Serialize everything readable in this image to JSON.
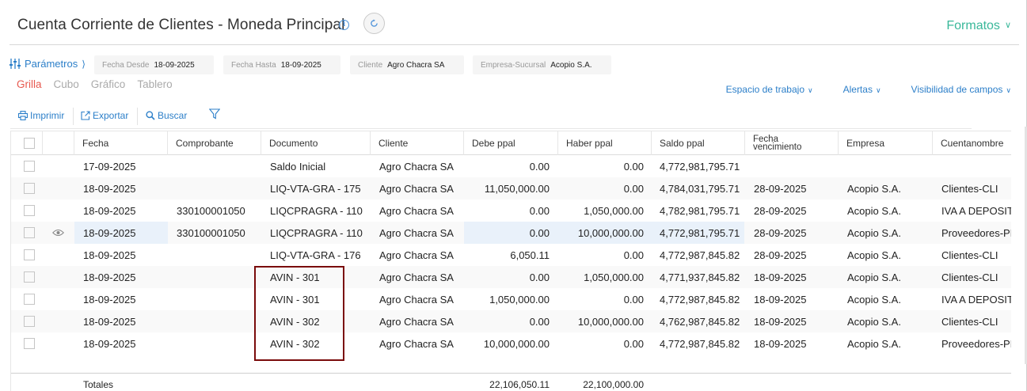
{
  "header": {
    "title": "Cuenta Corriente de Clientes - Moneda Principal",
    "formatos_label": "Formatos"
  },
  "params": {
    "label": "Parámetros",
    "filters": [
      {
        "label": "Fecha Desde",
        "value": "18-09-2025"
      },
      {
        "label": "Fecha Hasta",
        "value": "18-09-2025"
      },
      {
        "label": "Cliente",
        "value": "Agro Chacra SA"
      },
      {
        "label": "Empresa-Sucursal",
        "value": "Acopio S.A."
      }
    ]
  },
  "view_tabs": [
    "Grilla",
    "Cubo",
    "Gráfico",
    "Tablero"
  ],
  "right_links": [
    "Espacio de trabajo",
    "Alertas",
    "Visibilidad de campos"
  ],
  "toolbar": {
    "print_label": "Imprimir",
    "export_label": "Exportar",
    "search_label": "Buscar"
  },
  "columns": [
    "Fecha",
    "Comprobante",
    "Documento",
    "Cliente",
    "Debe ppal",
    "Haber ppal",
    "Saldo ppal",
    "Fecha vencimiento",
    "Empresa",
    "Cuentanombre"
  ],
  "rows": [
    {
      "fecha": "17-09-2025",
      "comprobante": "",
      "documento": "Saldo Inicial",
      "cliente": "Agro Chacra SA",
      "debe": "0.00",
      "haber": "0.00",
      "saldo": "4,772,981,795.71",
      "vencimiento": "",
      "empresa": "",
      "cuenta": ""
    },
    {
      "fecha": "18-09-2025",
      "comprobante": "",
      "documento": "LIQ-VTA-GRA - 175",
      "cliente": "Agro Chacra SA",
      "debe": "11,050,000.00",
      "haber": "0.00",
      "saldo": "4,784,031,795.71",
      "vencimiento": "28-09-2025",
      "empresa": "Acopio S.A.",
      "cuenta": "Clientes-CLI"
    },
    {
      "fecha": "18-09-2025",
      "comprobante": "330100001050",
      "documento": "LIQCPRAGRA - 110",
      "cliente": "Agro Chacra SA",
      "debe": "0.00",
      "haber": "1,050,000.00",
      "saldo": "4,782,981,795.71",
      "vencimiento": "28-09-2025",
      "empresa": "Acopio S.A.",
      "cuenta": "IVA A DEPOSITAR"
    },
    {
      "fecha": "18-09-2025",
      "comprobante": "330100001050",
      "documento": "LIQCPRAGRA - 110",
      "cliente": "Agro Chacra SA",
      "debe": "0.00",
      "haber": "10,000,000.00",
      "saldo": "4,772,981,795.71",
      "vencimiento": "28-09-2025",
      "empresa": "Acopio S.A.",
      "cuenta": "Proveedores-PROV"
    },
    {
      "fecha": "18-09-2025",
      "comprobante": "",
      "documento": "LIQ-VTA-GRA - 176",
      "cliente": "Agro Chacra SA",
      "debe": "6,050.11",
      "haber": "0.00",
      "saldo": "4,772,987,845.82",
      "vencimiento": "28-09-2025",
      "empresa": "Acopio S.A.",
      "cuenta": "Clientes-CLI"
    },
    {
      "fecha": "18-09-2025",
      "comprobante": "",
      "documento": "AVIN - 301",
      "cliente": "Agro Chacra SA",
      "debe": "0.00",
      "haber": "1,050,000.00",
      "saldo": "4,771,937,845.82",
      "vencimiento": "18-09-2025",
      "empresa": "Acopio S.A.",
      "cuenta": "Clientes-CLI"
    },
    {
      "fecha": "18-09-2025",
      "comprobante": "",
      "documento": "AVIN - 301",
      "cliente": "Agro Chacra SA",
      "debe": "1,050,000.00",
      "haber": "0.00",
      "saldo": "4,772,987,845.82",
      "vencimiento": "18-09-2025",
      "empresa": "Acopio S.A.",
      "cuenta": "IVA A DEPOSITAR"
    },
    {
      "fecha": "18-09-2025",
      "comprobante": "",
      "documento": "AVIN - 302",
      "cliente": "Agro Chacra SA",
      "debe": "0.00",
      "haber": "10,000,000.00",
      "saldo": "4,762,987,845.82",
      "vencimiento": "18-09-2025",
      "empresa": "Acopio S.A.",
      "cuenta": "Clientes-CLI"
    },
    {
      "fecha": "18-09-2025",
      "comprobante": "",
      "documento": "AVIN - 302",
      "cliente": "Agro Chacra SA",
      "debe": "10,000,000.00",
      "haber": "0.00",
      "saldo": "4,772,987,845.82",
      "vencimiento": "18-09-2025",
      "empresa": "Acopio S.A.",
      "cuenta": "Proveedores-PROV"
    }
  ],
  "totals": {
    "label": "Totales",
    "debe": "22,106,050.11",
    "haber": "22,100,000.00"
  },
  "colors": {
    "accent_blue": "#2c7fc9",
    "formatos_green": "#3ab89a",
    "active_tab_red": "#e7594f",
    "highlight_box": "#7a0b0b",
    "row_highlight": "#e9f1fa"
  }
}
